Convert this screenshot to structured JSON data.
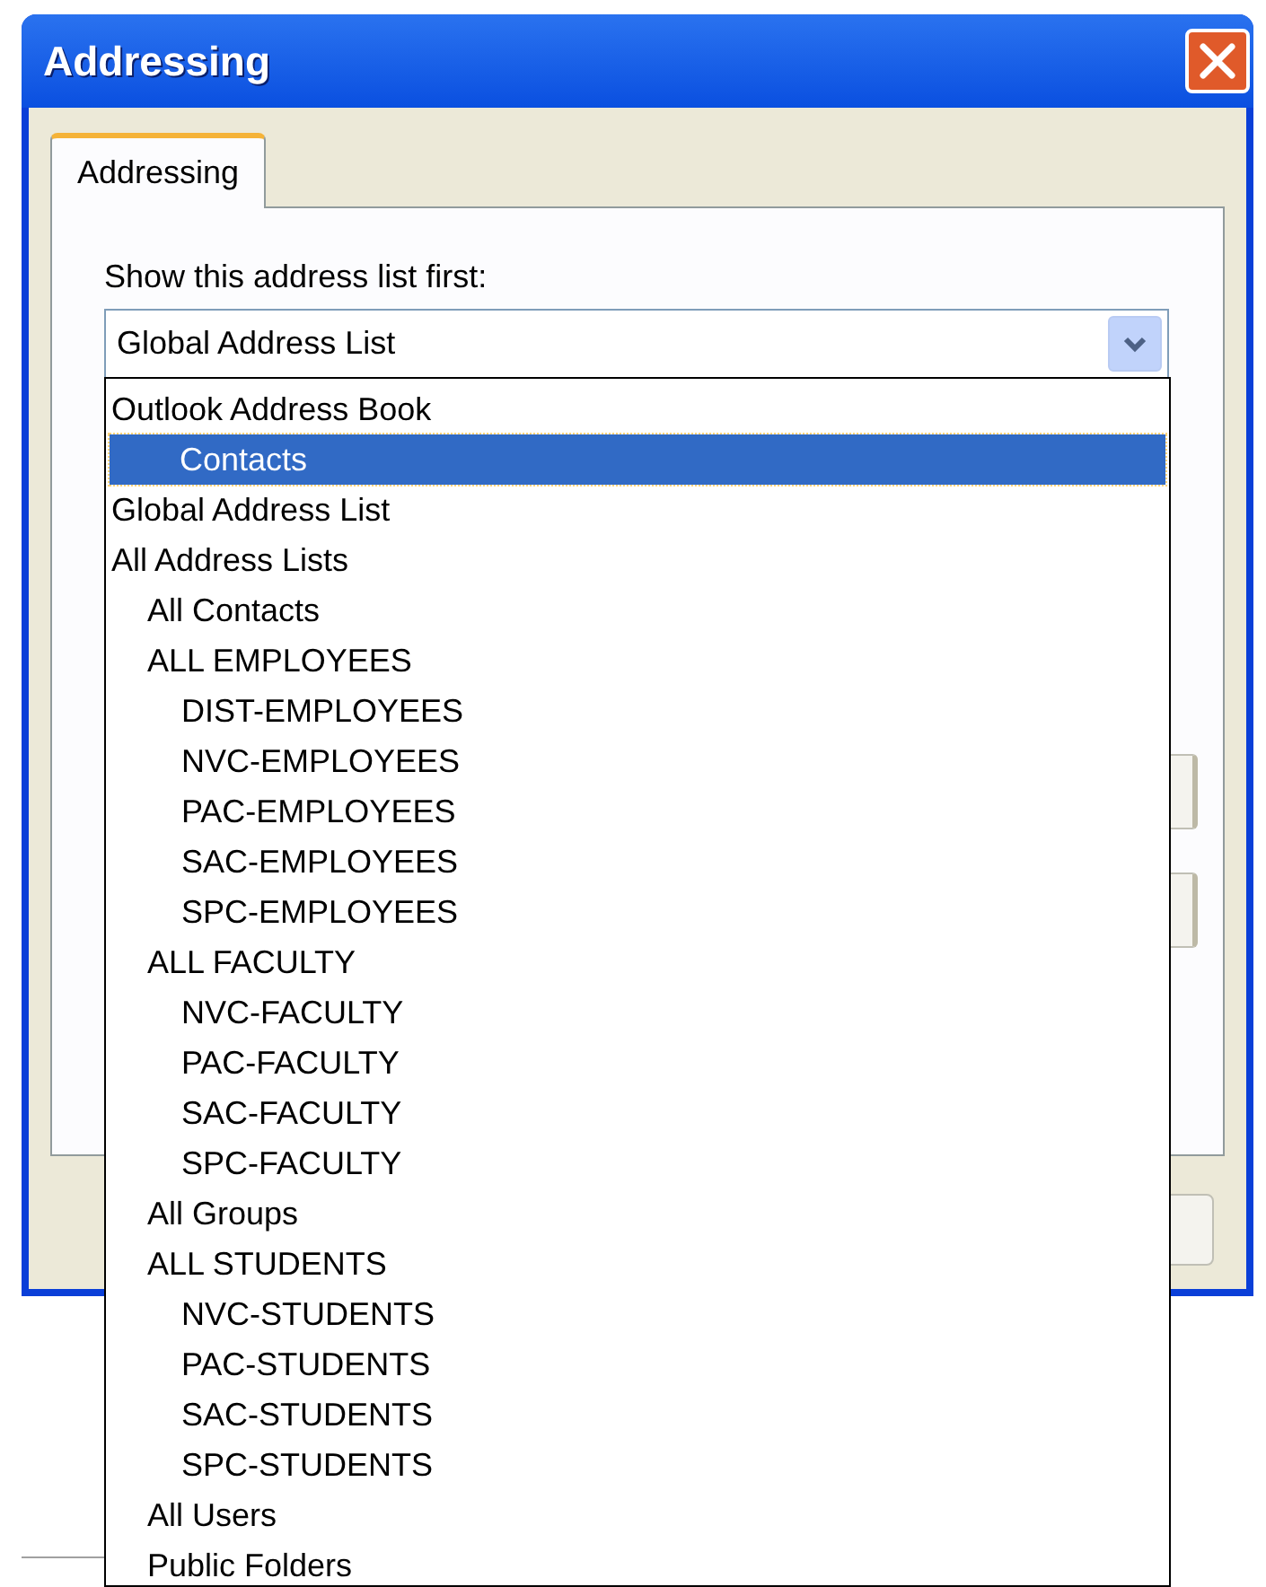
{
  "window": {
    "title": "Addressing"
  },
  "tabs": [
    {
      "label": "Addressing",
      "selected": true
    }
  ],
  "address_list_label": "Show this address list first:",
  "combo": {
    "value": "Global Address List",
    "expanded": true
  },
  "dropdown_items": [
    {
      "label": "Outlook Address Book",
      "selected": false,
      "children": [
        {
          "label": "Contacts",
          "selected": true
        }
      ]
    },
    {
      "label": "Global Address List",
      "selected": false
    },
    {
      "label": "All Address Lists",
      "selected": false,
      "children": [
        {
          "label": "All Contacts",
          "selected": false
        },
        {
          "label": "ALL EMPLOYEES",
          "selected": false,
          "children": [
            {
              "label": "DIST-EMPLOYEES",
              "selected": false
            },
            {
              "label": "NVC-EMPLOYEES",
              "selected": false
            },
            {
              "label": "PAC-EMPLOYEES",
              "selected": false
            },
            {
              "label": "SAC-EMPLOYEES",
              "selected": false
            },
            {
              "label": "SPC-EMPLOYEES",
              "selected": false
            }
          ]
        },
        {
          "label": "ALL FACULTY",
          "selected": false,
          "children": [
            {
              "label": "NVC-FACULTY",
              "selected": false
            },
            {
              "label": "PAC-FACULTY",
              "selected": false
            },
            {
              "label": "SAC-FACULTY",
              "selected": false
            },
            {
              "label": "SPC-FACULTY",
              "selected": false
            }
          ]
        },
        {
          "label": "All Groups",
          "selected": false
        },
        {
          "label": "ALL STUDENTS",
          "selected": false,
          "children": [
            {
              "label": "NVC-STUDENTS",
              "selected": false
            },
            {
              "label": "PAC-STUDENTS",
              "selected": false
            },
            {
              "label": "SAC-STUDENTS",
              "selected": false
            },
            {
              "label": "SPC-STUDENTS",
              "selected": false
            }
          ]
        },
        {
          "label": "All Users",
          "selected": false
        },
        {
          "label": "Public Folders",
          "selected": false
        }
      ]
    }
  ]
}
